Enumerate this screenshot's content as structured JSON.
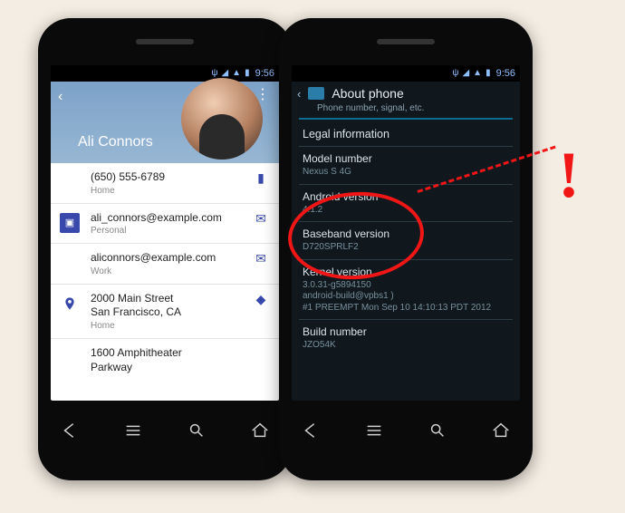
{
  "statusbar": {
    "time": "9:56"
  },
  "left": {
    "contact_name": "Ali Connors",
    "rows": [
      {
        "icon": "",
        "primary": "(650) 555-6789",
        "secondary": "Home",
        "action": "sms"
      },
      {
        "icon": "card",
        "primary": "ali_connors@example.com",
        "secondary": "Personal",
        "action": "mail"
      },
      {
        "icon": "",
        "primary": "aliconnors@example.com",
        "secondary": "Work",
        "action": "mail"
      },
      {
        "icon": "pin",
        "primary": "2000 Main Street",
        "secondary_line2": "San Francisco, CA",
        "secondary": "Home",
        "action": "directions"
      },
      {
        "icon": "",
        "primary": "1600 Amphitheater",
        "secondary_line2": "Parkway",
        "secondary": "",
        "action": ""
      }
    ]
  },
  "right": {
    "header_title": "About phone",
    "header_subtitle": "Phone number, signal, etc.",
    "items": [
      {
        "label": "Legal information",
        "value": ""
      },
      {
        "label": "Model number",
        "value": "Nexus S 4G"
      },
      {
        "label": "Android version",
        "value": "4.1.2"
      },
      {
        "label": "Baseband version",
        "value": "D720SPRLF2"
      },
      {
        "label": "Kernel version",
        "value": "3.0.31-g5894150\nandroid-build@vpbs1 )\n#1 PREEMPT Mon Sep 10 14:10:13 PDT 2012"
      },
      {
        "label": "Build number",
        "value": "JZO54K"
      }
    ]
  },
  "annotation": {
    "bang": "!"
  }
}
